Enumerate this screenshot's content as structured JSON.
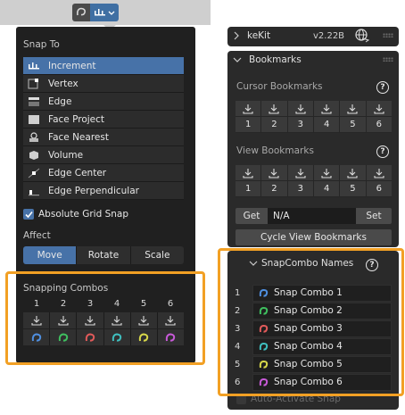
{
  "snap_popover": {
    "snap_to_title": "Snap To",
    "snap_items": [
      {
        "label": "Increment",
        "icon": "increment-icon",
        "active": true
      },
      {
        "label": "Vertex",
        "icon": "vertex-icon",
        "active": false
      },
      {
        "label": "Edge",
        "icon": "edge-icon",
        "active": false
      },
      {
        "label": "Face Project",
        "icon": "face-project-icon",
        "active": false
      },
      {
        "label": "Face Nearest",
        "icon": "face-nearest-icon",
        "active": false
      },
      {
        "label": "Volume",
        "icon": "volume-icon",
        "active": false
      },
      {
        "label": "Edge Center",
        "icon": "edge-center-icon",
        "active": false
      },
      {
        "label": "Edge Perpendicular",
        "icon": "edge-perpendicular-icon",
        "active": false
      }
    ],
    "absolute_grid_snap_label": "Absolute Grid Snap",
    "absolute_grid_snap_checked": true,
    "affect_title": "Affect",
    "affect_options": [
      {
        "label": "Move",
        "active": true
      },
      {
        "label": "Rotate",
        "active": false
      },
      {
        "label": "Scale",
        "active": false
      }
    ],
    "snapping_combos_title": "Snapping Combos",
    "combo_numbers": [
      "1",
      "2",
      "3",
      "4",
      "5",
      "6"
    ]
  },
  "kekit_panel": {
    "title": "keKit",
    "version": "v2.22B"
  },
  "bookmarks_panel": {
    "title": "Bookmarks",
    "cursor_title": "Cursor Bookmarks",
    "view_title": "View Bookmarks",
    "numbers": [
      "1",
      "2",
      "3",
      "4",
      "5",
      "6"
    ],
    "get_label": "Get",
    "field_value": "N/A",
    "set_label": "Set",
    "cycle_label": "Cycle View Bookmarks"
  },
  "snapcombo_names": {
    "title": "SnapCombo Names",
    "items": [
      {
        "num": "1",
        "name": "Snap Combo 1"
      },
      {
        "num": "2",
        "name": "Snap Combo 2"
      },
      {
        "num": "3",
        "name": "Snap Combo 3"
      },
      {
        "num": "4",
        "name": "Snap Combo 4"
      },
      {
        "num": "5",
        "name": "Snap Combo 5"
      },
      {
        "num": "6",
        "name": "Snap Combo 6"
      }
    ],
    "auto_activate_label": "Auto-Activate Snap"
  },
  "colors": {
    "accent": "#4772a8",
    "highlight": "#f2a024",
    "combo_colors": [
      "#4f8fe0",
      "#3fbf5f",
      "#e05a5a",
      "#3fbfbf",
      "#d8d84a",
      "#c85ad8"
    ]
  }
}
